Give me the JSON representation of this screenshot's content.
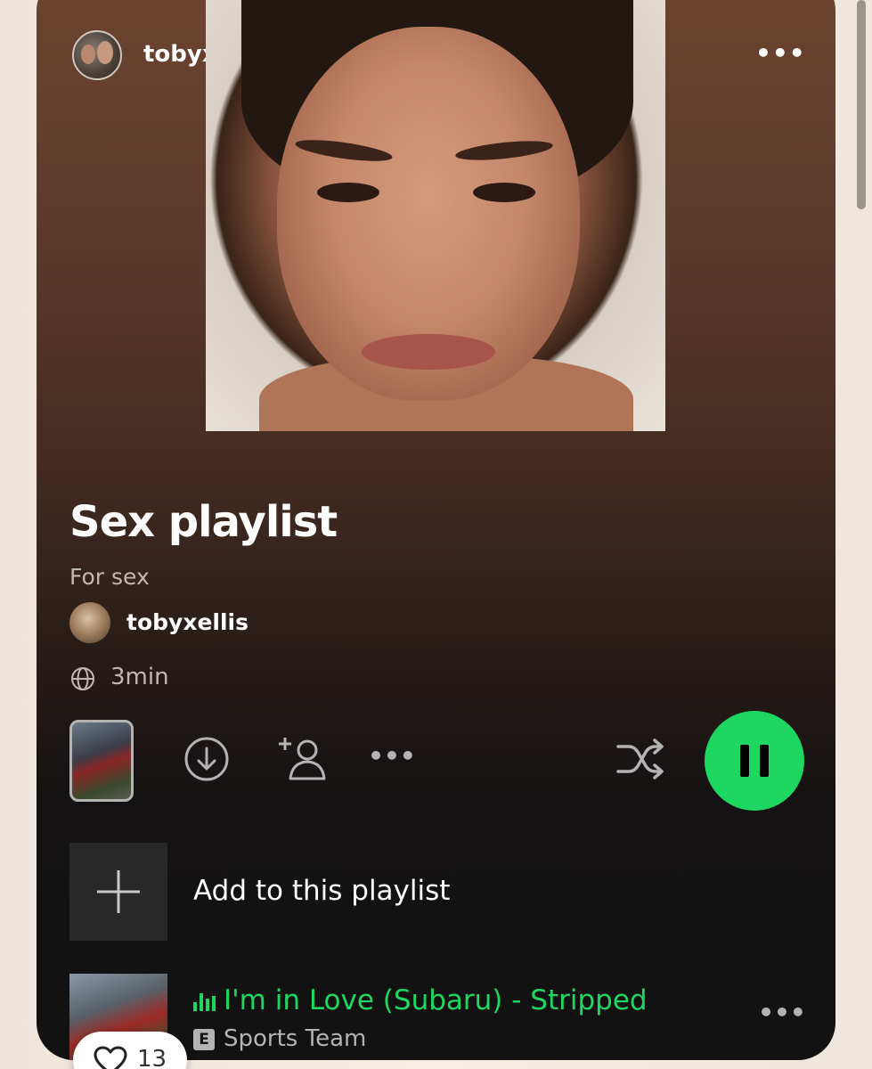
{
  "header": {
    "username": "tobyxellis",
    "more_label": "•••"
  },
  "playlist": {
    "title": "Sex playlist",
    "description": "For sex",
    "owner": "tobyxellis",
    "duration": "3min",
    "visibility_icon": "globe-icon"
  },
  "actions": {
    "more_label": "•••",
    "icons": [
      "download-icon",
      "add-user-icon",
      "shuffle-icon",
      "pause-icon"
    ],
    "accent_color": "#1ed760"
  },
  "add_row": {
    "label": "Add to this playlist"
  },
  "tracks": [
    {
      "title": "I'm in Love (Subaru) - Stripped",
      "artist": "Sports Team",
      "explicit_badge": "E",
      "playing": true,
      "more_label": "•••"
    }
  ],
  "reaction": {
    "likes": "13",
    "icon": "heart-icon"
  }
}
